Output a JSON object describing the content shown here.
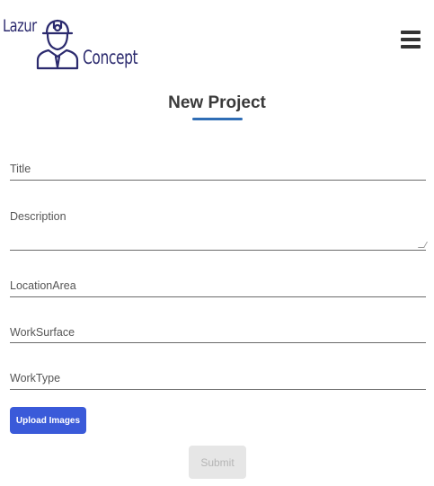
{
  "header": {
    "logo": {
      "word1": "Lazur",
      "word2": "Concept",
      "color": "#2b2a6e",
      "icon": "engineer-icon"
    },
    "menu_icon": "hamburger-menu-icon"
  },
  "main": {
    "title": "New Project",
    "accent_color": "#2f6db5",
    "fields": [
      {
        "label": "Title",
        "value": ""
      },
      {
        "label": "Description",
        "value": ""
      },
      {
        "label": "LocationArea",
        "value": ""
      },
      {
        "label": "WorkSurface",
        "value": ""
      },
      {
        "label": "WorkType",
        "value": ""
      }
    ],
    "upload_label": "Upload Images",
    "upload_color": "#3a5ad9",
    "submit_label": "Submit"
  }
}
